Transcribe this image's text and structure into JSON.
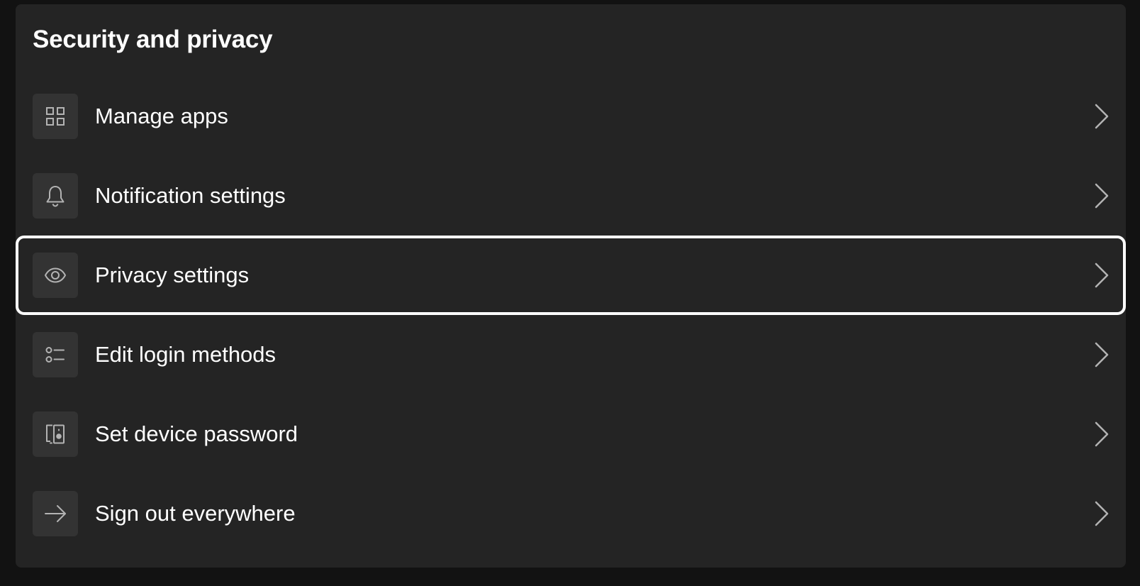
{
  "panel": {
    "title": "Security and privacy"
  },
  "menu": {
    "items": [
      {
        "label": "Manage apps",
        "icon": "grid-icon",
        "focused": false
      },
      {
        "label": "Notification settings",
        "icon": "bell-icon",
        "focused": false
      },
      {
        "label": "Privacy settings",
        "icon": "eye-icon",
        "focused": true
      },
      {
        "label": "Edit login methods",
        "icon": "list-icon",
        "focused": false
      },
      {
        "label": "Set device password",
        "icon": "device-icon",
        "focused": false
      },
      {
        "label": "Sign out everywhere",
        "icon": "arrow-right-icon",
        "focused": false
      }
    ]
  },
  "colors": {
    "page_background": "#121212",
    "panel_background": "#242424",
    "icon_background": "#333333",
    "icon_stroke": "#b3b3b3",
    "text": "#ffffff",
    "focus_ring": "#ffffff"
  }
}
